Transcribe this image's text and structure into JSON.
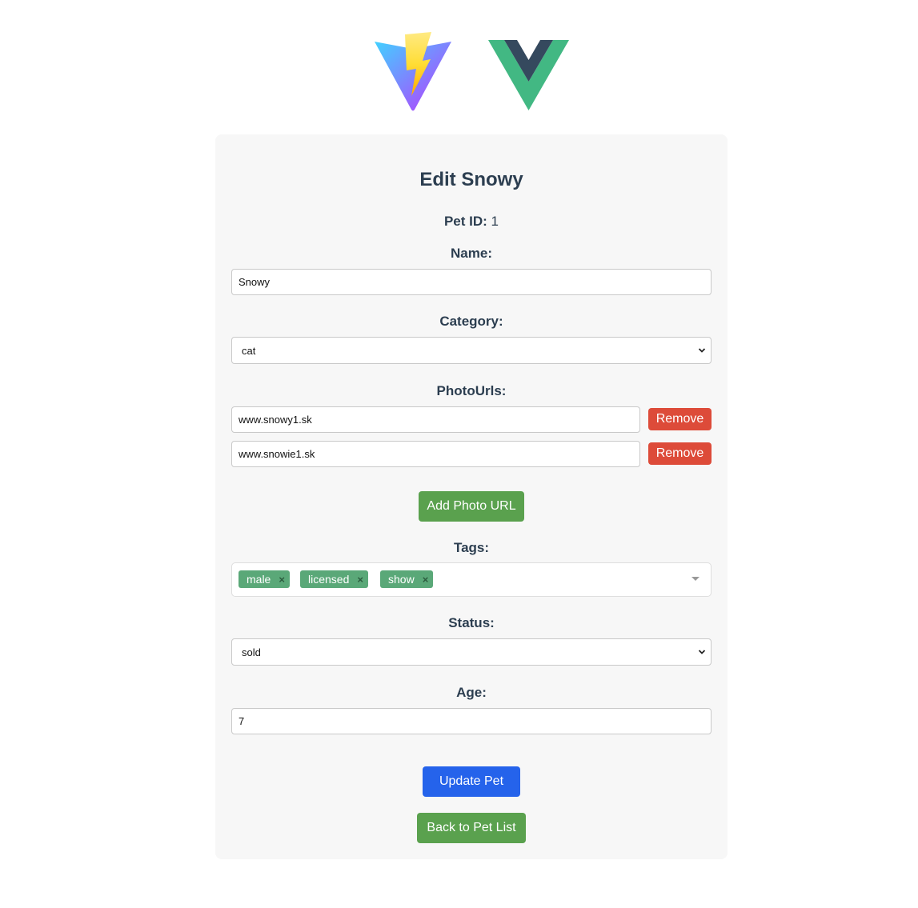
{
  "form": {
    "title": "Edit Snowy",
    "pet_id_label": "Pet ID:",
    "pet_id_value": "1",
    "name_label": "Name:",
    "name_value": "Snowy",
    "category_label": "Category:",
    "category_value": "cat",
    "photo_urls_label": "PhotoUrls:",
    "photo_urls": [
      "www.snowy1.sk",
      "www.snowie1.sk"
    ],
    "remove_label": "Remove",
    "add_photo_label": "Add Photo URL",
    "tags_label": "Tags:",
    "tags": [
      "male",
      "licensed",
      "show"
    ],
    "tag_remove_glyph": "×",
    "status_label": "Status:",
    "status_value": "sold",
    "age_label": "Age:",
    "age_value": "7",
    "update_label": "Update Pet",
    "back_label": "Back to Pet List"
  },
  "colors": {
    "remove": "#dd4b39",
    "green": "#5aa14e",
    "blue": "#2563eb",
    "tag": "#5aa878",
    "card": "#f7f7f7"
  },
  "icons": [
    "vite-logo-icon",
    "vue-logo-icon",
    "chevron-down-icon",
    "close-icon",
    "caret-down-icon"
  ]
}
